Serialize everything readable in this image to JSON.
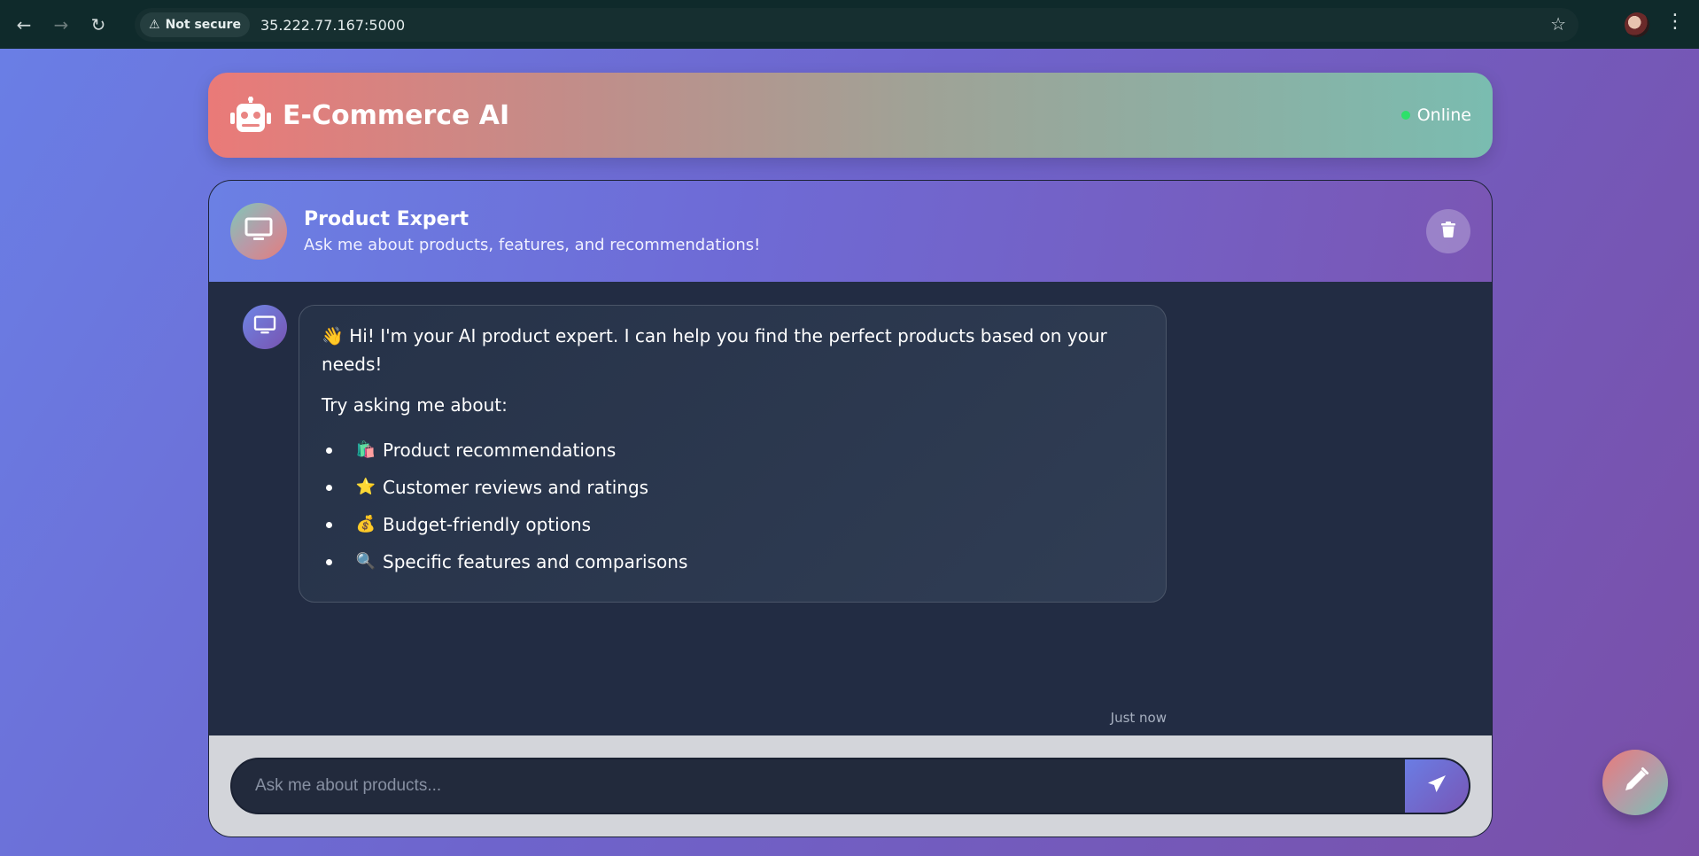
{
  "browser": {
    "security_label": "Not secure",
    "url": "35.222.77.167:5000"
  },
  "app": {
    "title": "E-Commerce AI",
    "status": "Online"
  },
  "chat": {
    "agent_name": "Product Expert",
    "agent_description": "Ask me about products, features, and recommendations!",
    "messages": [
      {
        "sender": "bot",
        "intro_emoji": "👋",
        "intro": "Hi! I'm your AI product expert. I can help you find the perfect products based on your needs!",
        "prompt": "Try asking me about:",
        "suggestions": [
          {
            "emoji": "🛍️",
            "text": "Product recommendations"
          },
          {
            "emoji": "⭐",
            "text": "Customer reviews and ratings"
          },
          {
            "emoji": "💰",
            "text": "Budget-friendly options"
          },
          {
            "emoji": "🔍",
            "text": "Specific features and comparisons"
          }
        ],
        "timestamp": "Just now"
      }
    ],
    "input_placeholder": "Ask me about products..."
  },
  "icons": {
    "robot": "robot-icon",
    "monitor": "monitor-icon",
    "trash": "trash-icon",
    "send": "paper-plane-icon",
    "edit": "pencil-icon"
  },
  "colors": {
    "status_online": "#2ee06a",
    "chat_background": "#222c43",
    "input_bar_background": "#d3d5da"
  }
}
